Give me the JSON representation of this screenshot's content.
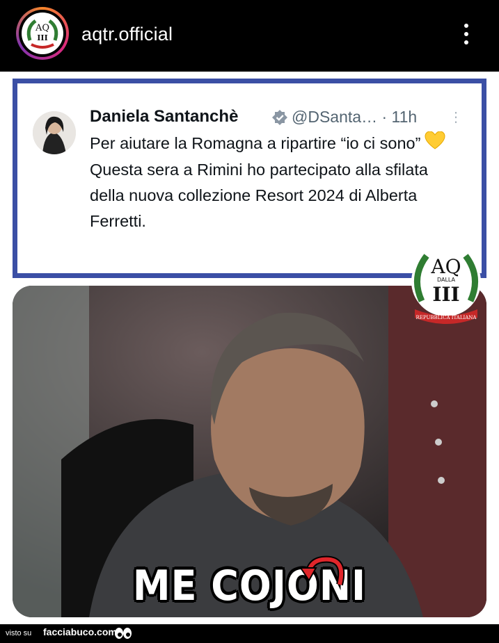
{
  "header": {
    "username": "aqtr.official",
    "menu_icon": "more-vertical-icon"
  },
  "tweet": {
    "name": "Daniela Santanchè",
    "handle": "@DSanta…",
    "time": "· 11h",
    "paragraph1": "Per aiutare la Romagna a ripartire “io ci sono”",
    "paragraph2": "Questa sera a Rimini ho partecipato alla sfilata della nuova collezione Resort 2024 di Alberta Ferretti.",
    "verified_icon": "verified-badge-icon",
    "emoji_icon": "yellow-heart-icon"
  },
  "logo": {
    "letters": "AQ",
    "subtitle": "DALLA",
    "numeral": "III",
    "ribbon": "REPUBBLICA ITALIANA"
  },
  "meme": {
    "caption": "ME COJONI"
  },
  "footer": {
    "visto": "visto su",
    "site": "facciabuco.com"
  },
  "colors": {
    "frame": "#3b4fa5",
    "verified": "#1d9bf0",
    "caption_arrow": "#e0262b",
    "logo_green": "#2f7d32",
    "logo_red": "#c62828"
  }
}
